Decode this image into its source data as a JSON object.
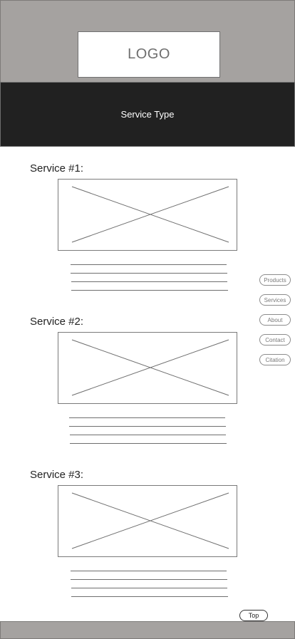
{
  "header": {
    "logo_text": "LOGO"
  },
  "banner": {
    "title": "Service Type"
  },
  "services": [
    {
      "title": "Service #1:"
    },
    {
      "title": "Service #2:"
    },
    {
      "title": "Service #3:"
    }
  ],
  "side_nav": [
    {
      "label": "Products"
    },
    {
      "label": "Services"
    },
    {
      "label": "About"
    },
    {
      "label": "Contact"
    },
    {
      "label": "Citation"
    }
  ],
  "top_button": {
    "label": "Top"
  }
}
